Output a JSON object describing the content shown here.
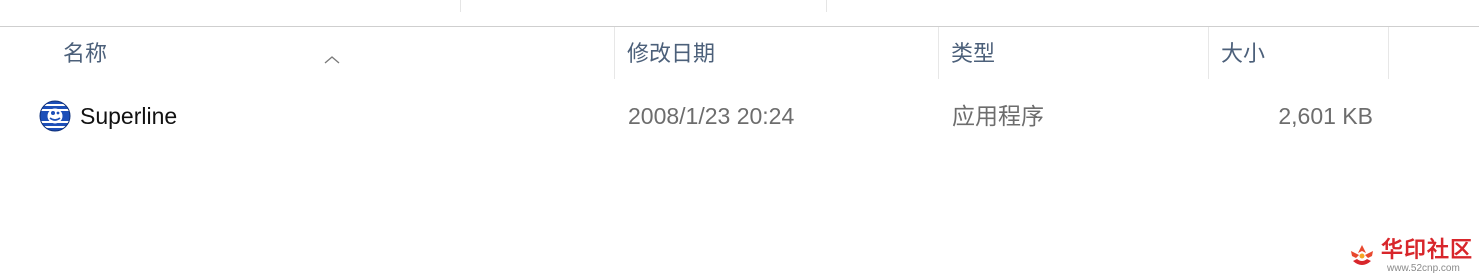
{
  "columns": {
    "name": "名称",
    "modified": "修改日期",
    "type": "类型",
    "size": "大小"
  },
  "sort": {
    "column": "name",
    "direction": "ascending",
    "indicator_icon": "chevron-up-icon"
  },
  "files": [
    {
      "icon": "application-icon",
      "name": "Superline",
      "modified": "2008/1/23 20:24",
      "type": "应用程序",
      "size": "2,601 KB"
    }
  ],
  "watermark": {
    "title": "华印社区",
    "url": "www.52cnp.com",
    "icon": "flower-logo"
  },
  "colors": {
    "header_text": "#4c607a",
    "row_text": "#6d6d6d",
    "watermark_red": "#d8262b"
  }
}
